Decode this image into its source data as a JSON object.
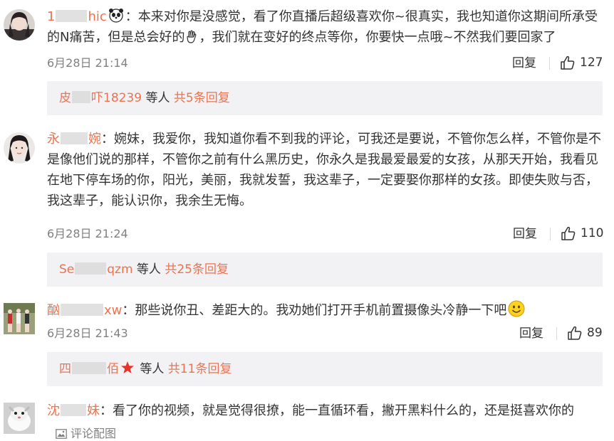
{
  "comments": [
    {
      "user_pre": "1",
      "user_post": "hic",
      "user_emoji_icon": "panda-face-icon",
      "text": "：本来对你是没感觉，看了你直播后超级喜欢你~很真实，我也知道你这期间所承受的N痛苦，但是总会好的",
      "text_emoji_icon": "ok-hand-icon",
      "text_after": "，我们就在变好的终点等你，你要快一点哦~不然我们要回家了",
      "time": "6月28日 21:14",
      "reply_label": "回复",
      "likes": "127",
      "replies": {
        "name_pre": "皮",
        "name_post": "吓18239",
        "mid": " 等人 ",
        "count": "共5条回复"
      }
    },
    {
      "user_pre": "永",
      "user_post": "婉",
      "text": "：婉妹，我爱你，我知道你看不到我的评论，可我还是要说，不管你怎么样，不管你是不是像他们说的那样，不管你之前有什么黑历史，你永久是我最爱最爱的女孩，从那天开始，我看见在地下停车场的你，阳光，美丽，我就发誓，我这辈子，一定要娶你那样的女孩。即使失败与否，我这辈子，能认识你，我余生无悔。",
      "time": "6月28日 21:24",
      "reply_label": "回复",
      "likes": "110",
      "replies": {
        "name_pre": "Se",
        "name_post": "qzm",
        "mid": " 等人 ",
        "count": "共25条回复"
      }
    },
    {
      "user_pre": "酗",
      "user_post": "xw",
      "text": "：那些说你丑、差距大的。我劝她们打开手机前置摄像头冷静一下吧",
      "text_emoji_icon": "smiley-face-icon",
      "time": "6月28日 21:43",
      "reply_label": "回复",
      "likes": "89",
      "replies": {
        "name_pre": "四",
        "name_post": "佰",
        "name_badge_icon": "red-star-icon",
        "mid": " 等人 ",
        "count": "共11条回复"
      }
    },
    {
      "user_pre": "沈",
      "user_post": "妹",
      "text": "：看了你的视频，就是觉得很撩，能一直循环看，撇开黑料什么的，还是挺喜欢你的",
      "pic_link": "评论配图",
      "pic_icon": "image-icon"
    }
  ],
  "icons": {
    "like": "thumbs-up-icon"
  },
  "colors": {
    "username": "#eb7350",
    "meta": "#808080",
    "reply_bg": "#f2f2f5",
    "text": "#333333"
  }
}
